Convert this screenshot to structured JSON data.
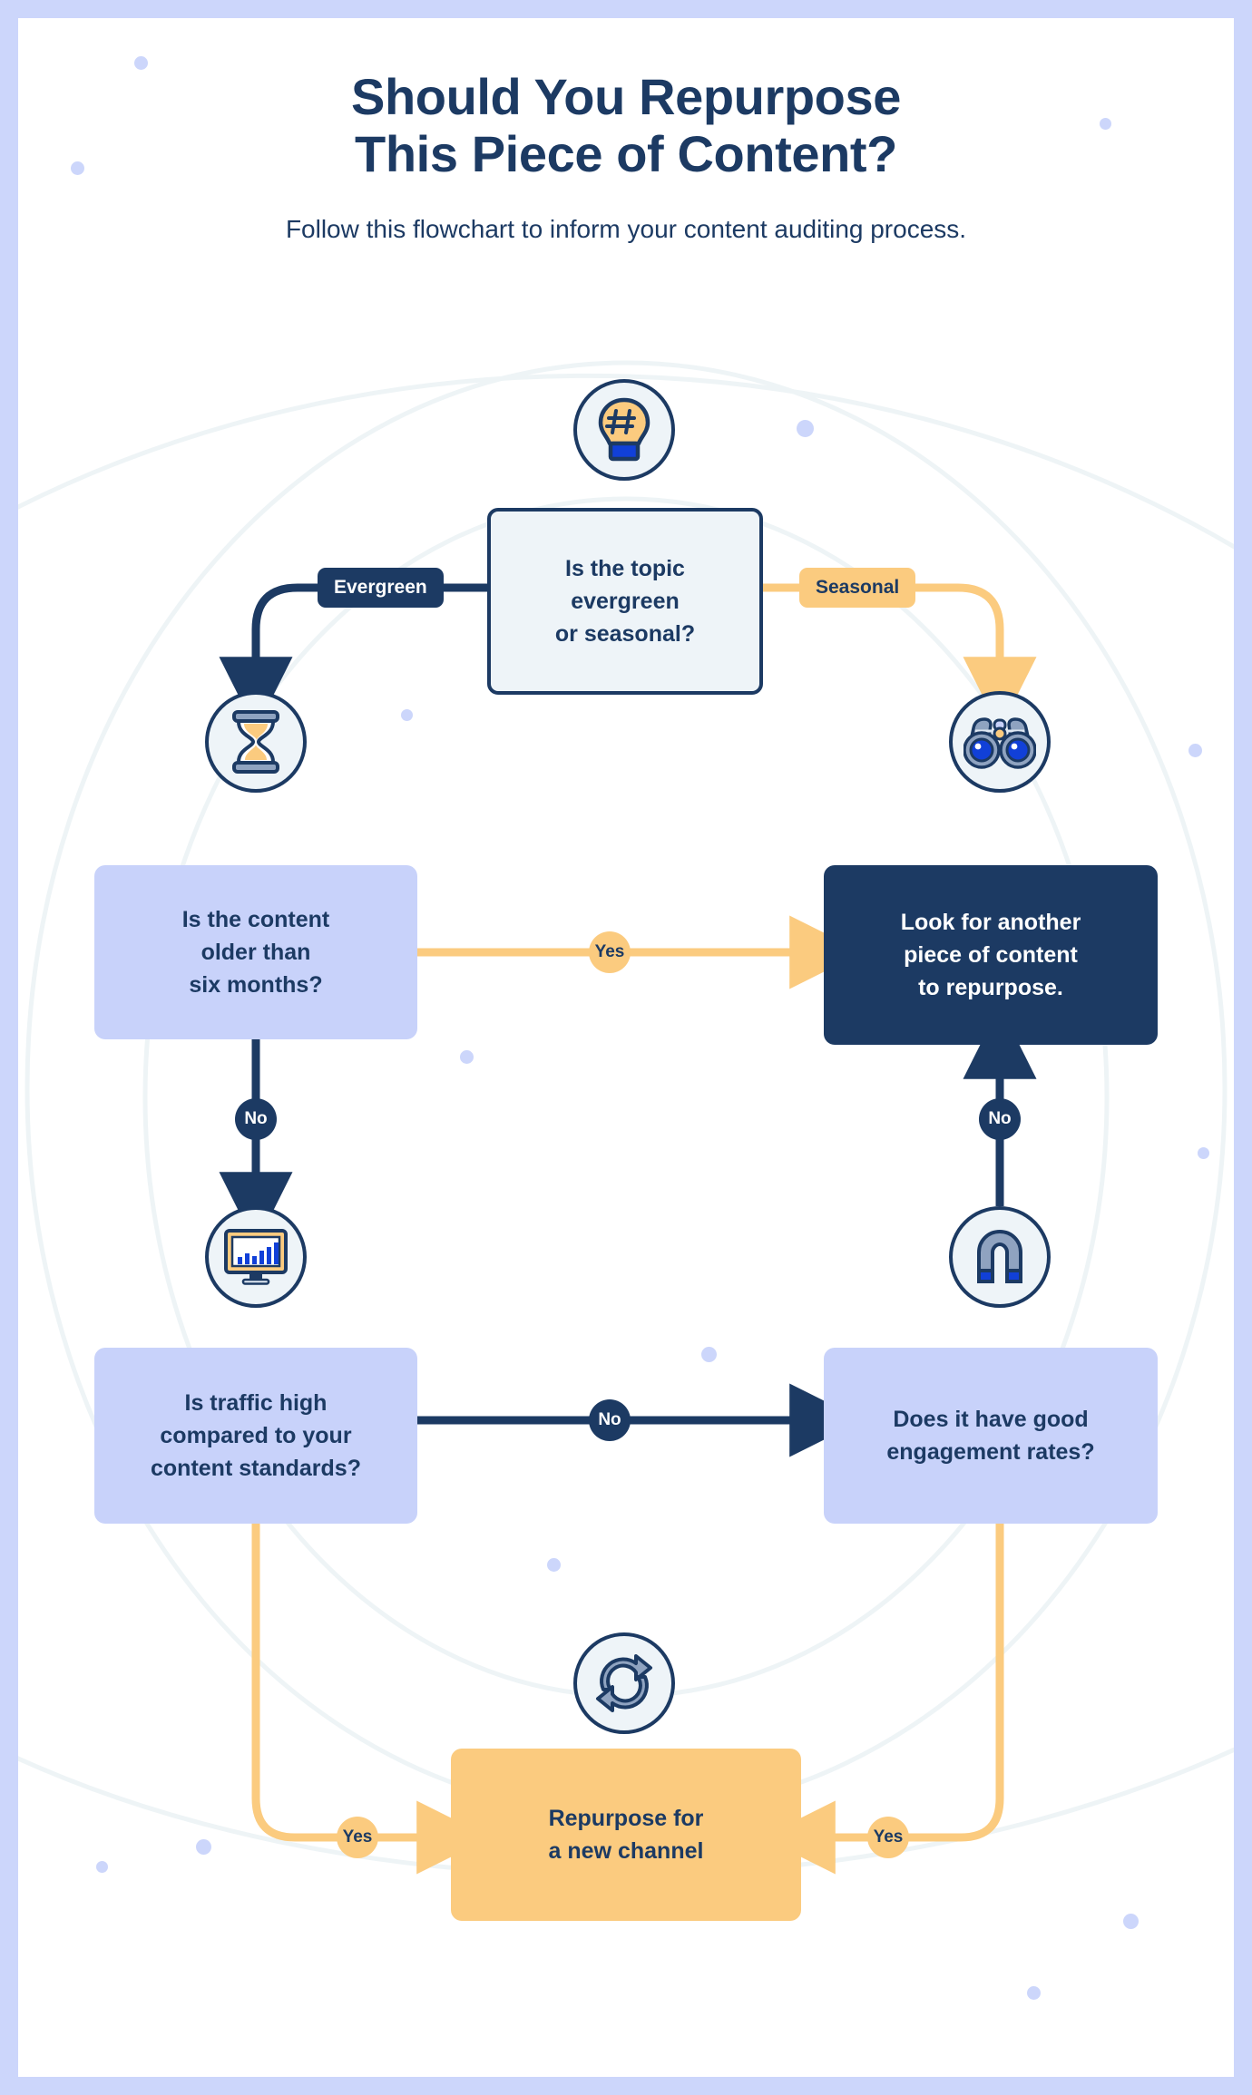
{
  "page": {
    "border_color": "#ccd6fb",
    "background": "#ffffff"
  },
  "header": {
    "title": "Should You Repurpose\nThis Piece of Content?",
    "subtitle": "Follow this flowchart to inform your content auditing process."
  },
  "palette": {
    "navy": "#1c3a63",
    "amber": "#fbcb7f",
    "periwinkle": "#c8d2fa",
    "pale_blue": "#eef4f8",
    "blue": "#1140d8",
    "white": "#ffffff",
    "border_frame": "#ccd6fb",
    "decor_line": "#eef4f6"
  },
  "chart_data": {
    "type": "diagram",
    "title": "Should You Repurpose This Piece of Content?",
    "subtitle": "Follow this flowchart to inform your content auditing process.",
    "nodes": [
      {
        "id": "topic",
        "label": "Is the topic\nevergreen\nor seasonal?",
        "kind": "start",
        "icon": "lightbulb-hashtag-icon",
        "fill": "#eef4f8",
        "text_color": "#1c3a63"
      },
      {
        "id": "age",
        "label": "Is the content\nolder than\nsix months?",
        "kind": "question",
        "icon": "hourglass-icon",
        "fill": "#c8d2fa",
        "text_color": "#1c3a63"
      },
      {
        "id": "lookother",
        "label": "Look for another\npiece of content\nto repurpose.",
        "kind": "dark",
        "icon": "binoculars-icon",
        "fill": "#1c3a63",
        "text_color": "#ffffff"
      },
      {
        "id": "traffic",
        "label": "Is traffic high\ncompared to your\ncontent standards?",
        "kind": "question",
        "icon": "monitor-chart-icon",
        "fill": "#c8d2fa",
        "text_color": "#1c3a63"
      },
      {
        "id": "engagement",
        "label": "Does it have good\nengagement rates?",
        "kind": "question",
        "icon": "magnet-icon",
        "fill": "#c8d2fa",
        "text_color": "#1c3a63"
      },
      {
        "id": "repurpose",
        "label": "Repurpose for\na new channel",
        "kind": "result",
        "icon": "recycle-refresh-icon",
        "fill": "#fbcb7f",
        "text_color": "#1c3a63"
      }
    ],
    "edges": [
      {
        "from": "topic",
        "to": "age",
        "label": "Evergreen",
        "style": "navy",
        "badge": "pill"
      },
      {
        "from": "topic",
        "to": "lookother",
        "label": "Seasonal",
        "style": "amber",
        "badge": "pill"
      },
      {
        "from": "age",
        "to": "lookother",
        "label": "Yes",
        "style": "amber",
        "badge": "circle"
      },
      {
        "from": "age",
        "to": "traffic",
        "label": "No",
        "style": "navy",
        "badge": "circle"
      },
      {
        "from": "traffic",
        "to": "engagement",
        "label": "No",
        "style": "navy",
        "badge": "circle"
      },
      {
        "from": "traffic",
        "to": "repurpose",
        "label": "Yes",
        "style": "amber",
        "badge": "circle"
      },
      {
        "from": "engagement",
        "to": "lookother",
        "label": "No",
        "style": "navy",
        "badge": "circle"
      },
      {
        "from": "engagement",
        "to": "repurpose",
        "label": "Yes",
        "style": "amber",
        "badge": "circle"
      }
    ]
  },
  "labels": {
    "evergreen": "Evergreen",
    "seasonal": "Seasonal",
    "yes_age": "Yes",
    "no_age": "No",
    "no_traffic": "No",
    "yes_traffic": "Yes",
    "no_engagement": "No",
    "yes_engagement": "Yes"
  },
  "nodes": {
    "topic": "Is the topic\nevergreen\nor seasonal?",
    "age": "Is the content\nolder than\nsix months?",
    "lookother": "Look for another\npiece of content\nto repurpose.",
    "traffic": "Is traffic high\ncompared to your\ncontent standards?",
    "engagement": "Does it have good\nengagement rates?",
    "repurpose": "Repurpose for\na new channel"
  }
}
